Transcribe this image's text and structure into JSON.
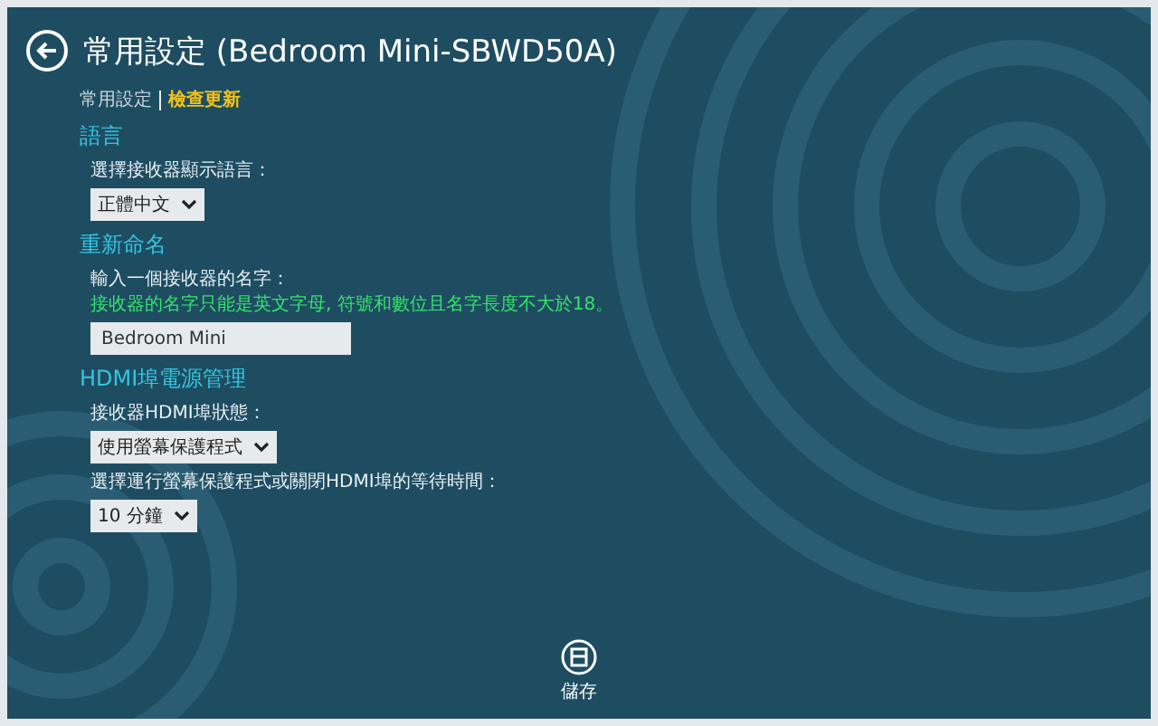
{
  "header": {
    "title": "常用設定 (Bedroom Mini-SBWD50A)"
  },
  "breadcrumb": [
    {
      "label": "常用設定",
      "selected": true
    },
    {
      "label": "檢查更新",
      "selected": false
    }
  ],
  "sections": [
    {
      "heading": "語言",
      "fields": [
        {
          "kind": "select",
          "label": "選擇接收器顯示語言：",
          "value": "正體中文"
        }
      ]
    },
    {
      "heading": "重新命名",
      "fields": [
        {
          "kind": "text",
          "label": "輸入一個接收器的名字：",
          "hint": "接收器的名字只能是英文字母, 符號和數位且名字長度不大於18。",
          "value": "Bedroom Mini"
        }
      ]
    },
    {
      "heading": "HDMI埠電源管理",
      "fields": [
        {
          "kind": "select",
          "label": "接收器HDMI埠狀態：",
          "value": "使用螢幕保護程式"
        },
        {
          "kind": "select",
          "label": "選擇運行螢幕保護程式或關閉HDMI埠的等待時間：",
          "value": "10 分鐘"
        }
      ]
    }
  ],
  "save": {
    "label": "儲存"
  }
}
